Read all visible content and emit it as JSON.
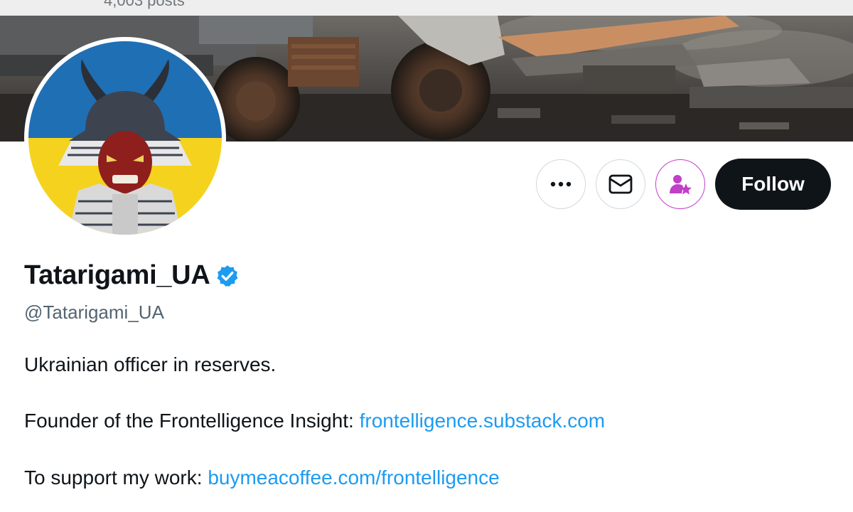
{
  "header": {
    "posts_count": "4,003 posts"
  },
  "profile": {
    "display_name": "Tatarigami_UA",
    "handle": "@Tatarigami_UA",
    "verified": true,
    "verified_color": "#1d9bf0"
  },
  "actions": {
    "more_icon": "more-horizontal-icon",
    "message_icon": "envelope-icon",
    "subscribe_icon": "person-star-icon",
    "follow_label": "Follow"
  },
  "bio": {
    "line1": "Ukrainian officer in reserves.",
    "line2_prefix": "Founder of the Frontelligence Insight: ",
    "line2_link": "frontelligence.substack.com",
    "line3_prefix": "To support my work: ",
    "line3_link": "buymeacoffee.com/frontelligence"
  },
  "colors": {
    "link": "#1d9bf0",
    "text": "#0f1419",
    "secondary_text": "#536471",
    "follow_bg": "#0f1419",
    "subscribe_accent": "#c13fc9",
    "flag_blue": "#1f6fb5",
    "flag_yellow": "#f5d21d"
  }
}
